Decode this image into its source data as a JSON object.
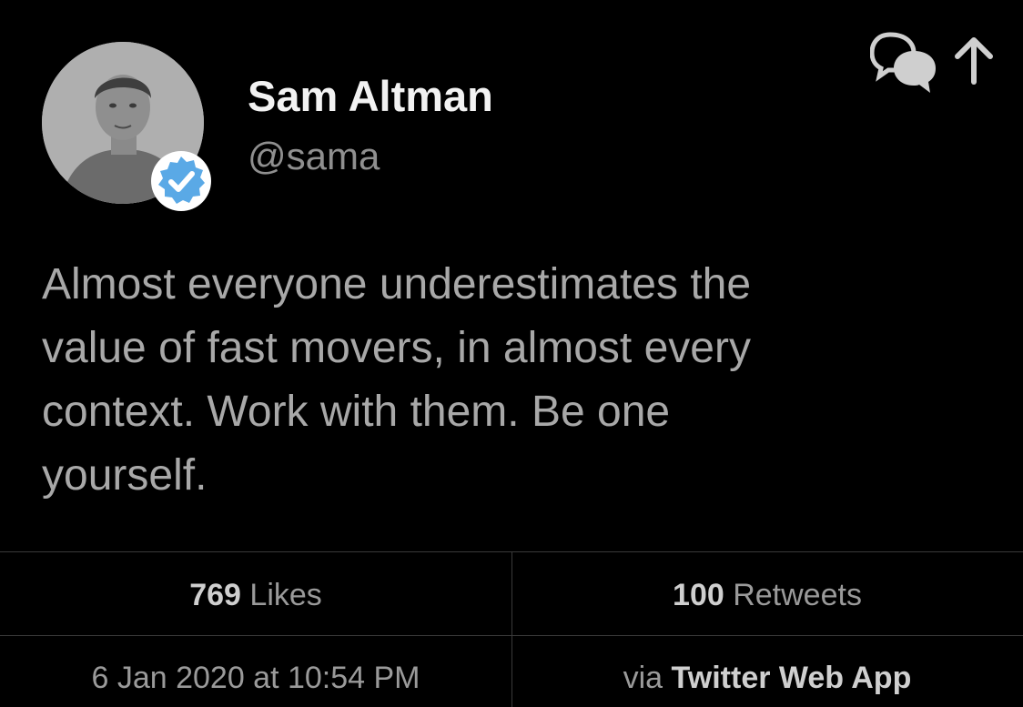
{
  "author": {
    "name": "Sam Altman",
    "handle": "@sama",
    "verified": true
  },
  "tweet": {
    "text": "Almost everyone underestimates the\nvalue of fast movers, in almost every\ncontext.  Work with them.  Be one\nyourself."
  },
  "stats": {
    "likes_count": "769",
    "likes_label": "Likes",
    "retweets_count": "100",
    "retweets_label": "Retweets"
  },
  "meta": {
    "timestamp": "6 Jan 2020 at 10:54 PM",
    "via_label": "via",
    "source": "Twitter Web App"
  },
  "icons": {
    "reply": "reply-icon",
    "share": "share-icon",
    "verified": "verified-badge-icon"
  },
  "colors": {
    "background": "#000000",
    "name": "#f2f2f2",
    "handle": "#8f8f8f",
    "tweet_text": "#a8a8a8",
    "stat_number": "#cfcfcf",
    "stat_label": "#9a9a9a",
    "verified_blue": "#5aa9e6",
    "divider": "#3a3a3a"
  }
}
